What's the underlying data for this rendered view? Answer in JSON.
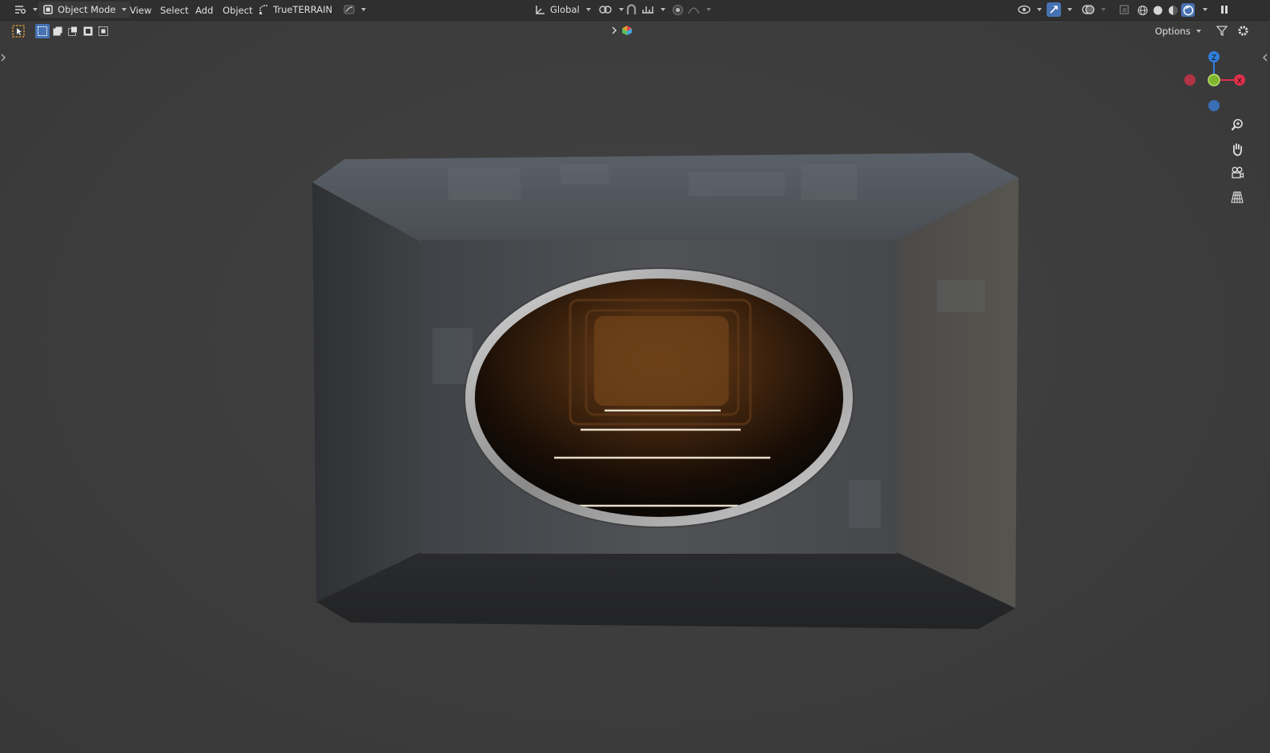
{
  "header": {
    "mode_label": "Object Mode",
    "menus": [
      "View",
      "Select",
      "Add",
      "Object"
    ],
    "addon_label": "TrueTERRAIN",
    "orientation_label": "Global"
  },
  "toolbar": {
    "options_label": "Options"
  },
  "gizmo": {
    "z_label": "Z",
    "x_label": "X",
    "colors": {
      "x": "#e0304a",
      "y": "#7fb52c",
      "z": "#2f7fdc",
      "neg_x": "#b33246",
      "neg_z": "#3a6fb5"
    }
  },
  "colors": {
    "accent": "#4772b3",
    "header_bg": "#2f2f2f",
    "viewport_bg": "#3d3d3d"
  },
  "icons": [
    "editor-type-icon",
    "object-mode-icon",
    "addon-icon",
    "transform-orientation-icon",
    "pivot-icon",
    "snap-icon",
    "snap-increment-icon",
    "proportional-edit-icon",
    "falloff-icon",
    "visibility-icon",
    "gizmo-icon",
    "overlay-icon",
    "xray-icon",
    "wireframe-shading-icon",
    "solid-shading-icon",
    "material-shading-icon",
    "rendered-shading-icon",
    "pause-icon",
    "select-box-icon",
    "zoom-icon",
    "hand-pan-icon",
    "camera-icon",
    "ortho-grid-icon",
    "filter-icon",
    "settings-icon",
    "assets-icon"
  ]
}
